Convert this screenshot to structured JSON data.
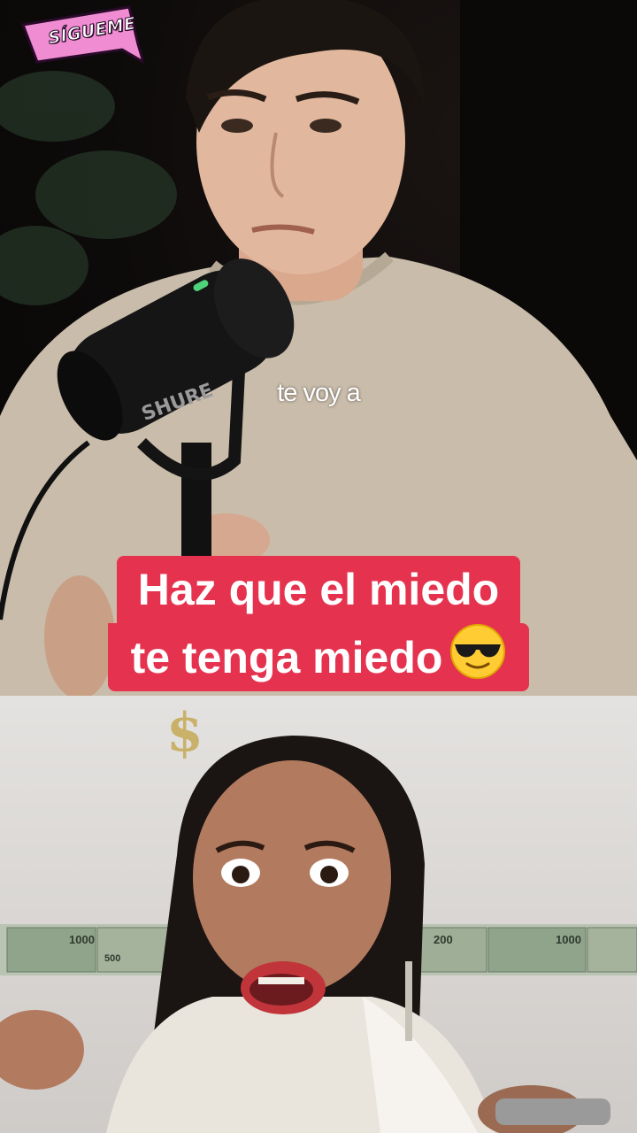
{
  "sticker": {
    "text": "SÍGUEME",
    "color": "#f08cd2"
  },
  "top_video": {
    "subtitle": "te voy a",
    "mic_brand": "SHURE"
  },
  "caption": {
    "line1": "Haz que el miedo",
    "line2": "te tenga miedo",
    "emoji": "sunglasses-face",
    "background": "#e5334f"
  },
  "bottom_video": {
    "banknotes": [
      "1000",
      "500",
      "200",
      "1000"
    ]
  }
}
